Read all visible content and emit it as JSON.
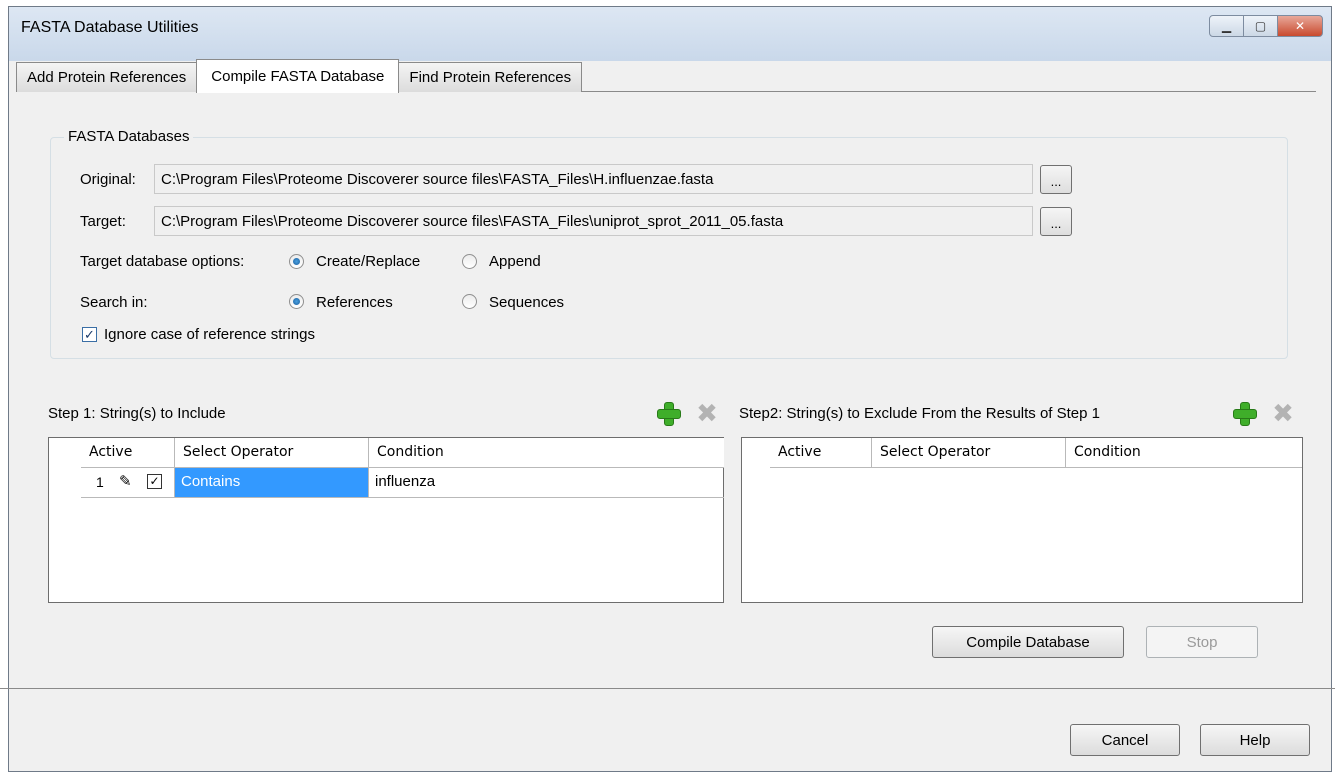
{
  "window": {
    "title": "FASTA Database Utilities"
  },
  "tabs": [
    {
      "label": "Add Protein References"
    },
    {
      "label": "Compile FASTA Database"
    },
    {
      "label": "Find Protein References"
    }
  ],
  "fasta": {
    "group_label": "FASTA Databases",
    "original_label": "Original:",
    "original_path": "C:\\Program Files\\Proteome Discoverer source files\\FASTA_Files\\H.influenzae.fasta",
    "target_label": "Target:",
    "target_path": "C:\\Program Files\\Proteome Discoverer source files\\FASTA_Files\\uniprot_sprot_2011_05.fasta",
    "browse_label": "...",
    "target_options_label": "Target database options:",
    "create_replace": "Create/Replace",
    "append": "Append",
    "search_in_label": "Search in:",
    "references": "References",
    "sequences": "Sequences",
    "ignore_case": "Ignore case of reference strings"
  },
  "step1": {
    "label": "Step 1: String(s) to Include",
    "headers": [
      "Active",
      "Select Operator",
      "Condition"
    ],
    "rows": [
      {
        "num": "1",
        "operator": "Contains",
        "condition": "influenza"
      }
    ]
  },
  "step2": {
    "label": "Step2: String(s) to Exclude From the Results of Step 1",
    "headers": [
      "Active",
      "Select Operator",
      "Condition"
    ]
  },
  "buttons": {
    "compile": "Compile Database",
    "stop": "Stop",
    "cancel": "Cancel",
    "help": "Help"
  }
}
